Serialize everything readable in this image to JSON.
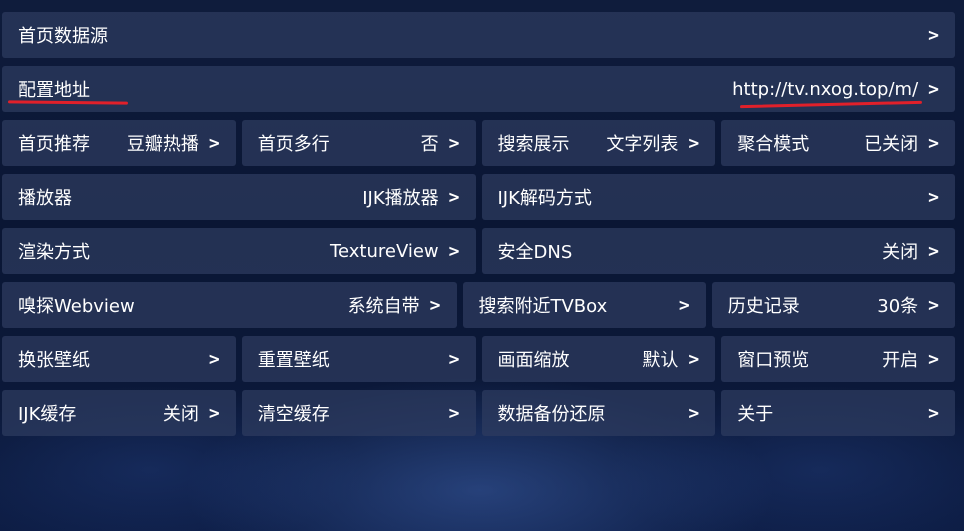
{
  "rows": [
    {
      "cells": [
        {
          "label": "首页数据源",
          "value": ""
        }
      ]
    },
    {
      "cells": [
        {
          "label": "配置地址",
          "value": "http://tv.nxog.top/m/"
        }
      ]
    },
    {
      "cells": [
        {
          "label": "首页推荐",
          "value": "豆瓣热播"
        },
        {
          "label": "首页多行",
          "value": "否"
        },
        {
          "label": "搜索展示",
          "value": "文字列表"
        },
        {
          "label": "聚合模式",
          "value": "已关闭"
        }
      ]
    },
    {
      "cells": [
        {
          "label": "播放器",
          "value": "IJK播放器"
        },
        {
          "label": "IJK解码方式",
          "value": ""
        }
      ]
    },
    {
      "cells": [
        {
          "label": "渲染方式",
          "value": "TextureView"
        },
        {
          "label": "安全DNS",
          "value": "关闭"
        }
      ]
    },
    {
      "cells": [
        {
          "label": "嗅探Webview",
          "value": "系统自带"
        },
        {
          "label": "搜索附近TVBox",
          "value": ""
        },
        {
          "label": "历史记录",
          "value": "30条"
        }
      ]
    },
    {
      "cells": [
        {
          "label": "换张壁纸",
          "value": ""
        },
        {
          "label": "重置壁纸",
          "value": ""
        },
        {
          "label": "画面缩放",
          "value": "默认"
        },
        {
          "label": "窗口预览",
          "value": "开启"
        }
      ]
    },
    {
      "cells": [
        {
          "label": "IJK缓存",
          "value": "关闭"
        },
        {
          "label": "清空缓存",
          "value": ""
        },
        {
          "label": "数据备份还原",
          "value": ""
        },
        {
          "label": "关于",
          "value": ""
        }
      ]
    }
  ],
  "chevron": ">",
  "icons": {
    "chevron": "chevron-right-icon"
  },
  "colors": {
    "annotation_underline": "#e0202a",
    "cell_background": "#2e3c5f"
  }
}
